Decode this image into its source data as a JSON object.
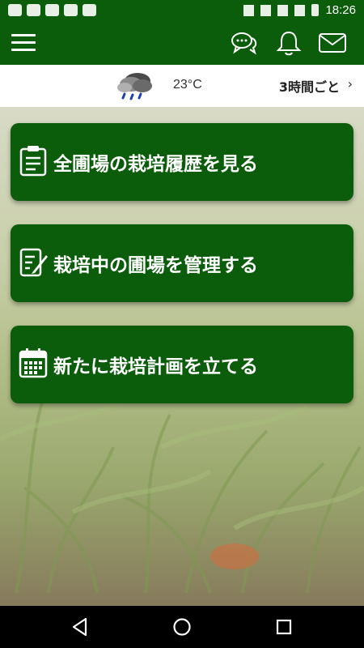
{
  "status_bar": {
    "time": "18:26",
    "left_icons": [
      "line-icon",
      "line-icon",
      "image-icon",
      "image-icon",
      "download-icon"
    ],
    "right_icons": [
      "bluetooth-icon",
      "vibrate-icon",
      "wifi-icon",
      "signal-icon",
      "battery-icon"
    ]
  },
  "header": {
    "menu_icon": "hamburger-menu-icon",
    "chat_icon": "chat-icon",
    "bell_icon": "bell-icon",
    "mail_icon": "mail-icon"
  },
  "weather": {
    "icon": "rain-cloud-icon",
    "temperature": "23°C",
    "link_label": "3時間ごと",
    "chevron": "›"
  },
  "menu": [
    {
      "label": "全圃場の栽培履歴を見る",
      "icon": "clipboard-list-icon"
    },
    {
      "label": "栽培中の圃場を管理する",
      "icon": "edit-note-icon"
    },
    {
      "label": "新たに栽培計画を立てる",
      "icon": "calendar-icon"
    }
  ],
  "nav": {
    "back": "back-triangle-icon",
    "home": "home-circle-icon",
    "recents": "recents-square-icon"
  },
  "colors": {
    "primary": "#0b5c0b",
    "button_text": "#ffffff"
  }
}
